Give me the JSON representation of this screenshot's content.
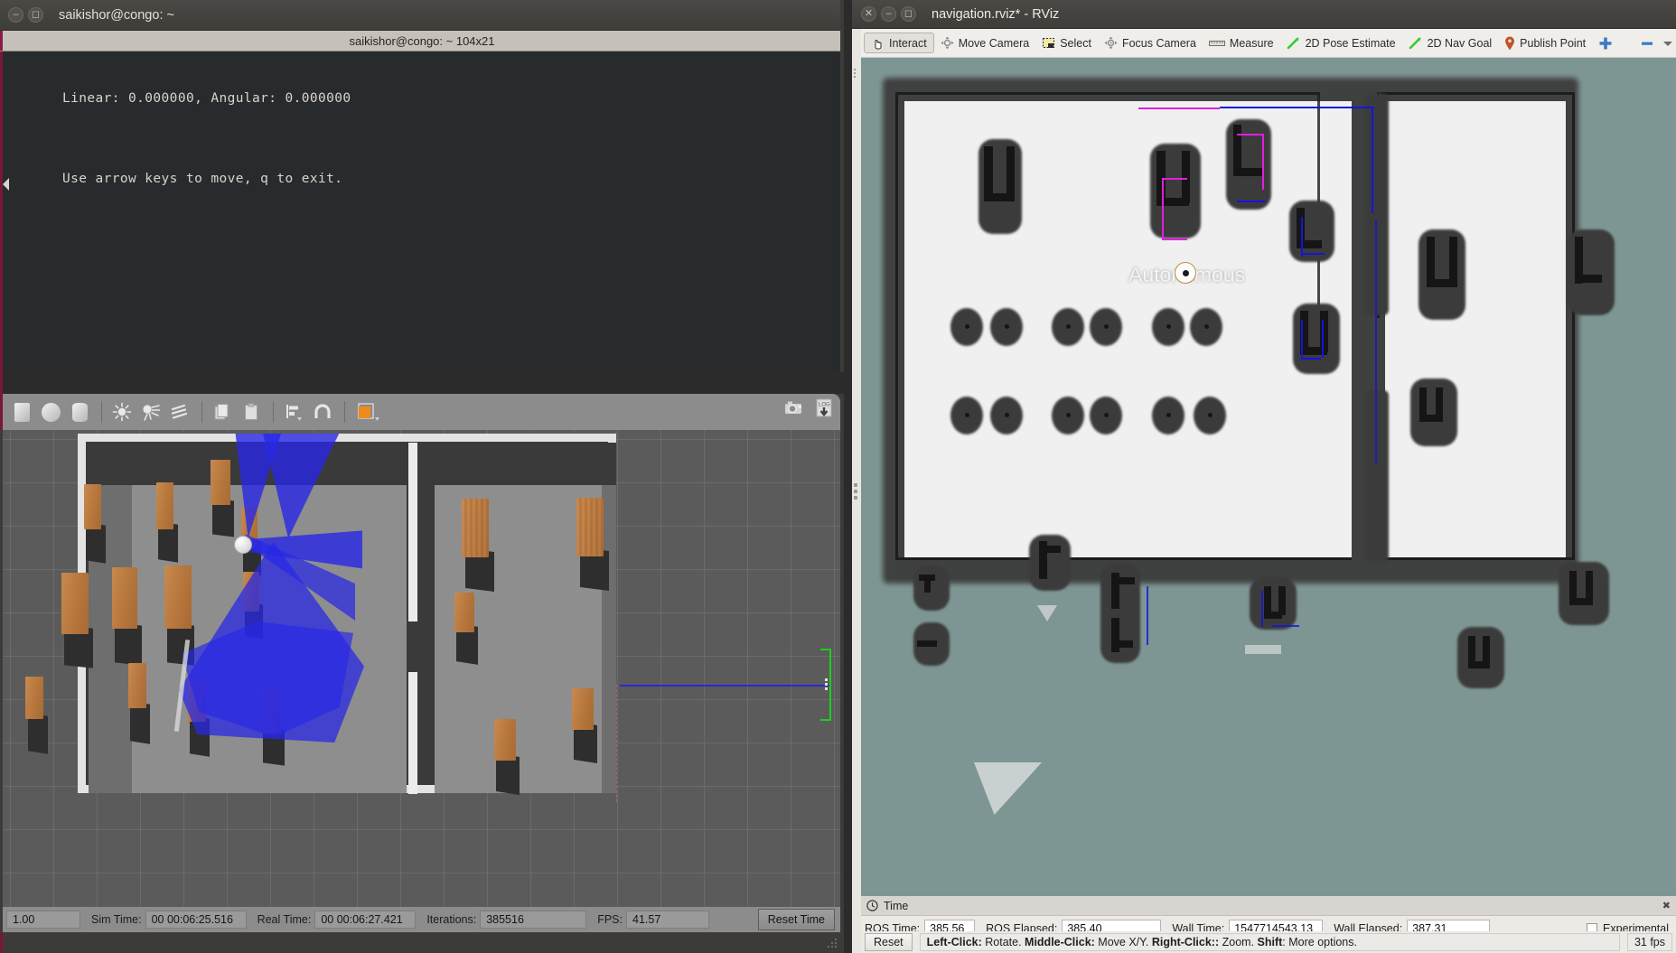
{
  "terminal": {
    "window_title": "saikishor@congo: ~",
    "tab_title": "saikishor@congo: ~ 104x21",
    "line1": "Linear: 0.000000, Angular: 0.000000",
    "line2": "Use arrow keys to move, q to exit."
  },
  "gazebo": {
    "toolbar_icons": [
      "box-icon",
      "sphere-icon",
      "cylinder-icon",
      "point-light-icon",
      "spot-light-icon",
      "directional-light-icon",
      "copy-icon",
      "paste-icon",
      "align-icon",
      "snap-icon",
      "view-angle-icon"
    ],
    "right_icons": [
      "screenshot-icon",
      "log-record-icon"
    ],
    "status": {
      "rtf_value": "1.00",
      "sim_time_label": "Sim Time:",
      "sim_time_value": "00 00:06:25.516",
      "real_time_label": "Real Time:",
      "real_time_value": "00 00:06:27.421",
      "iterations_label": "Iterations:",
      "iterations_value": "385516",
      "fps_label": "FPS:",
      "fps_value": "41.57",
      "reset_time_label": "Reset Time"
    }
  },
  "rviz": {
    "window_title": "navigation.rviz* - RViz",
    "toolbar": [
      {
        "label": "Interact",
        "icon": "hand-cursor-icon",
        "active": true
      },
      {
        "label": "Move Camera",
        "icon": "move-camera-icon",
        "active": false
      },
      {
        "label": "Select",
        "icon": "select-rect-icon",
        "active": false
      },
      {
        "label": "Focus Camera",
        "icon": "focus-camera-icon",
        "active": false
      },
      {
        "label": "Measure",
        "icon": "ruler-icon",
        "active": false
      },
      {
        "label": "2D Pose Estimate",
        "icon": "green-arrow-icon",
        "active": false
      },
      {
        "label": "2D Nav Goal",
        "icon": "green-arrow-icon",
        "active": false
      },
      {
        "label": "Publish Point",
        "icon": "map-pin-icon",
        "active": false
      }
    ],
    "toolbar_extra": [
      "plus-icon",
      "minus-icon",
      "chevron-down-icon"
    ],
    "map_label": "Autonomous",
    "time_panel": {
      "header": "Time",
      "close_icon": "close-icon",
      "ros_time_label": "ROS Time:",
      "ros_time_value": "385.56",
      "ros_elapsed_label": "ROS Elapsed:",
      "ros_elapsed_value": "385.40",
      "wall_time_label": "Wall Time:",
      "wall_time_value": "1547714543.13",
      "wall_elapsed_label": "Wall Elapsed:",
      "wall_elapsed_value": "387.31",
      "experimental_label": "Experimental"
    },
    "bottom": {
      "reset_label": "Reset",
      "hint_parts": [
        {
          "text": "Left-Click:",
          "bold": true
        },
        {
          "text": " Rotate. ",
          "bold": false
        },
        {
          "text": "Middle-Click:",
          "bold": true
        },
        {
          "text": " Move X/Y. ",
          "bold": false
        },
        {
          "text": "Right-Click::",
          "bold": true
        },
        {
          "text": " Zoom. ",
          "bold": false
        },
        {
          "text": "Shift",
          "bold": true
        },
        {
          "text": ": More options.",
          "bold": false
        }
      ],
      "fps": "31 fps"
    }
  },
  "colors": {
    "terminal_bg": "#272b2d",
    "terminal_accent": "#7a1639",
    "gazebo_panel": "#8c8c8c",
    "rviz_bg": "#eceae6",
    "map_free": "#f0f0f0",
    "map_occupied": "#3c3c3c",
    "map_unknown": "#7e9693",
    "laser_blue": "#2828e6",
    "scan_pink": "#e21ee2",
    "nav_goal_green": "#35c935"
  }
}
